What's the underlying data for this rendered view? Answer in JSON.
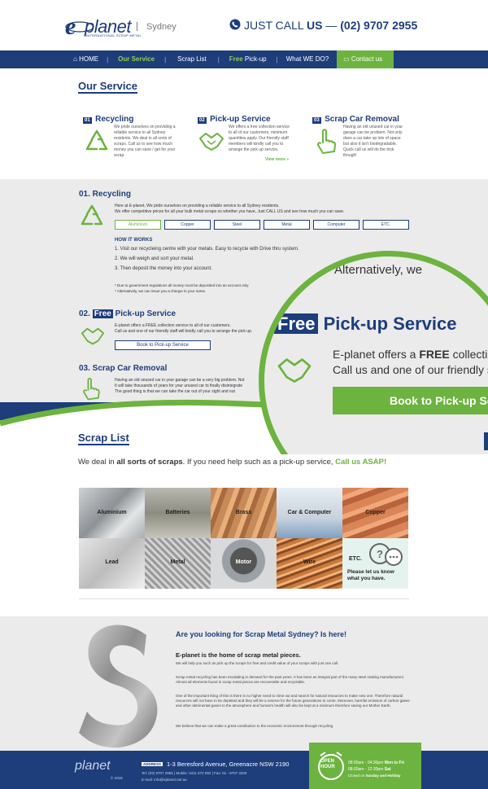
{
  "header": {
    "logo_text": "planet",
    "logo_sub": "INTERNATIONAL SCRAP METAL",
    "city": "Sydney",
    "phone_prefix": "JUST CALL ",
    "phone_us": "US",
    "phone_dash": " — ",
    "phone_number": "(02) 9707 2955"
  },
  "nav": {
    "home": "HOME",
    "our_service": "Our Service",
    "scrap_list": "Scrap List",
    "free": "Free",
    "pickup": " Pick-up",
    "what_we_do": "What WE DO?",
    "contact": "Contact us"
  },
  "service": {
    "title": "Our Service",
    "items": [
      {
        "num": "01",
        "title": "Recycling",
        "text": "We pride ourselves on providing a reliable service to all Sydney residents. We deal in all sorts of scraps. Call us to see how much money you can save / get for your scrap."
      },
      {
        "num": "02",
        "title": "Pick-up Service",
        "text": "We offers a free collection service to all of our customers, minimum quantities apply. Our friendly staff members will kindly call you to arrange the pick up service."
      },
      {
        "num": "03",
        "title": "Scrap Car Removal",
        "text": "Having an old unused car in your garage can be problem. Not only does a car take up lots of space but also it isn't biodegradable. Quick call us will do the trick though!"
      }
    ],
    "view_more": "View more »"
  },
  "recycling": {
    "title": "01. Recycling",
    "intro": "Here at E-planet, We pride ourselves on providing a reliable service to all Sydney residents.",
    "intro2": "We offer competitive prices for all your bulk metal scraps so whether you have, Just CALL US and see how much you can save.",
    "tabs": [
      "Aluminium",
      "Copper",
      "Steel",
      "Metal",
      "Computer",
      "ETC."
    ],
    "how_title": "HOW IT WORKS",
    "steps": [
      "1. Visit our recycleing centre with your metals. Easy to recycle with Drive thru system.",
      "2. We will weigh and sort your metal.",
      "3. Then deposit the money into your account."
    ],
    "note1": "* Due to government regulations all money must be deposited into an account only.",
    "note2": "* Alternatively, we can issue you a cheque in your name."
  },
  "pickup": {
    "title_free": "Free",
    "title_rest": " Pick-up Service",
    "text1": "E-planet offers a FREE collection service to all of our customers.",
    "text2": "Call us and one of our friendly staff will kindly call you to arrange the pick up.",
    "button": "Book to Pick-up Service"
  },
  "car_removal": {
    "title": "03. Scrap Car Removal",
    "text1": "Having an old unused car in your garage can be a very big problem. Not",
    "text2": "It will take thousands of years for your unused car to finally disintegrate",
    "text3": "The good thing is that we can take the car out of your sight and out"
  },
  "zoom": {
    "alt_text": "Alternatively, we",
    "free": "Free",
    "title_rest": " Pick-up Service",
    "line1_a": "E-planet offers a ",
    "line1_b": "FREE",
    "line1_c": " collection",
    "line2": "Call us and one of our friendly st",
    "button": "Book to Pick-up Se"
  },
  "scrap_list": {
    "title": "Scrap List",
    "intro_a": "We deal in ",
    "intro_b": "all sorts of scraps",
    "intro_c": ". If you need help such as a pick-up service, ",
    "intro_d": "Call us ASAP!",
    "tiles": [
      "Aluminium",
      "Batteries",
      "Brass",
      "Car & Computer",
      "Copper",
      "Lead",
      "Metal",
      "Motor",
      "Wire",
      "ETC."
    ],
    "etc_text": "Please let us know what you have."
  },
  "about": {
    "heading": "Are you looking for Scrap Metal Sydney? Is here!",
    "sub": "E-planet is the home of scrap metal pieces.",
    "p1": "We will help you such as pick up the scraps for free and credit value of your scraps with just one call.",
    "p2": "Scrap metal recycling has been escalating in demand for the past years. It has been an integral part of the many steel making manufacturers. Almost all elements found in scrap metal pieces are recoverable and recyclable.",
    "p3": "One of the important thing of this is there is no higher need to mine out and search for natural resources to make new one. Therefore natural resources will not have to be depleted and they will be a reserve for the future generations to come. Moreover, harmful emission of carbon gases and other detrimental gases to the atmosphere and human's health will also be kept at a minimum therefore saving our Mother Earth.",
    "p4": "We believe that we can make a great contribution to the economic environment through recycling."
  },
  "footer": {
    "copyright": "© 2018",
    "address_label": "ADDRESS",
    "address": "1-3 Beresford Avenue, Greenacre NSW 2190",
    "tel": "Tel: (02) 9707 2955  |  Mobile: 0411 572 082  |  Fax: 01 - 9707 3200",
    "email": "E-mail: info@eplanet.net.au",
    "open": "OPEN",
    "hour": "HOUR",
    "time1": "08:00am - 04:30pm",
    "day1": "Mon to Fri",
    "time2": "08:00am - 12:30pm",
    "day2": "Sat",
    "closed": "Closed on",
    "closed_days": "Sunday and Holiday"
  }
}
